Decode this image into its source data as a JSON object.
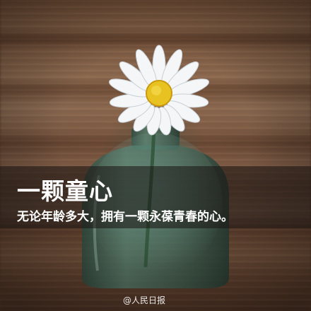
{
  "image": {
    "title": "一颗童心",
    "subtitle": "无论年龄多大，拥有一颗永葆青春的心。",
    "watermark": "@人民日报"
  },
  "colors": {
    "wood_dark": "#5a3a28",
    "wood_light": "#8c6a50",
    "bottle_glass": "#3f6a5c",
    "petal": "#f4f6f8",
    "flower_center": "#e8c220",
    "text": "#ffffff"
  },
  "icons": [
    "daisy-flower",
    "glass-bottle"
  ]
}
